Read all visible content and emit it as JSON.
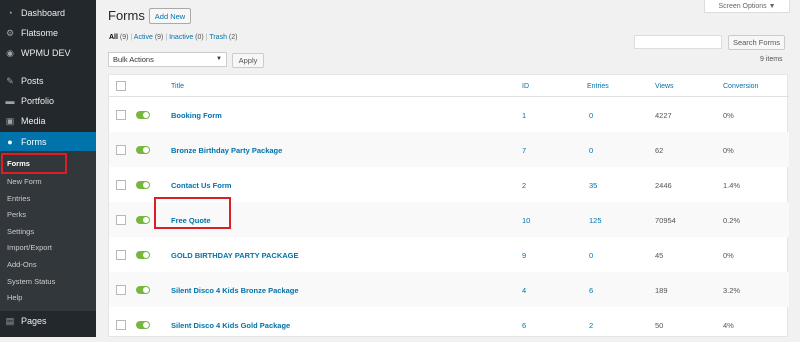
{
  "sidebar": {
    "items": [
      {
        "label": "Dashboard",
        "icon": "dashboard-icon"
      },
      {
        "label": "Flatsome",
        "icon": "flatsome-icon"
      },
      {
        "label": "WPMU DEV",
        "icon": "wpmudev-icon"
      },
      {
        "label": "Posts",
        "icon": "pin-icon"
      },
      {
        "label": "Portfolio",
        "icon": "folder-icon"
      },
      {
        "label": "Media",
        "icon": "media-icon"
      },
      {
        "label": "Forms",
        "icon": "forms-icon"
      },
      {
        "label": "Pages",
        "icon": "pages-icon"
      }
    ],
    "submenu": [
      "Forms",
      "New Form",
      "Entries",
      "Perks",
      "Settings",
      "Import/Export",
      "Add-Ons",
      "System Status",
      "Help"
    ]
  },
  "header": {
    "title": "Forms",
    "add_new": "Add New",
    "screen_options": "Screen Options ▼"
  },
  "views": {
    "all": "All",
    "all_count": "(9)",
    "active": "Active",
    "active_count": "(9)",
    "inactive": "Inactive",
    "inactive_count": "(0)",
    "trash": "Trash",
    "trash_count": "(2)"
  },
  "search": {
    "button": "Search Forms",
    "value": ""
  },
  "bulk": {
    "selected": "Bulk Actions",
    "apply": "Apply"
  },
  "items_count": "9 items",
  "table": {
    "columns": [
      "Title",
      "ID",
      "Entries",
      "Views",
      "Conversion"
    ],
    "rows": [
      {
        "title": "Booking Form",
        "id": "1",
        "entries": "0",
        "views": "4227",
        "conversion": "0%"
      },
      {
        "title": "Bronze Birthday Party Package",
        "id": "7",
        "entries": "0",
        "views": "62",
        "conversion": "0%"
      },
      {
        "title": "Contact Us Form",
        "id": "2",
        "entries": "35",
        "views": "2446",
        "conversion": "1.4%"
      },
      {
        "title": "Free Quote",
        "id": "10",
        "entries": "125",
        "views": "70954",
        "conversion": "0.2%"
      },
      {
        "title": "GOLD BIRTHDAY PARTY PACKAGE",
        "id": "9",
        "entries": "0",
        "views": "45",
        "conversion": "0%"
      },
      {
        "title": "Silent Disco 4 Kids Bronze Package",
        "id": "4",
        "entries": "6",
        "views": "189",
        "conversion": "3.2%"
      },
      {
        "title": "Silent Disco 4 Kids Gold Package",
        "id": "6",
        "entries": "2",
        "views": "50",
        "conversion": "4%"
      }
    ]
  },
  "colors": {
    "sidebar": "#23282d",
    "active": "#0073aa",
    "link": "#0073aa",
    "highlight": "#dc1f26",
    "toggle_on": "#76b83f"
  }
}
